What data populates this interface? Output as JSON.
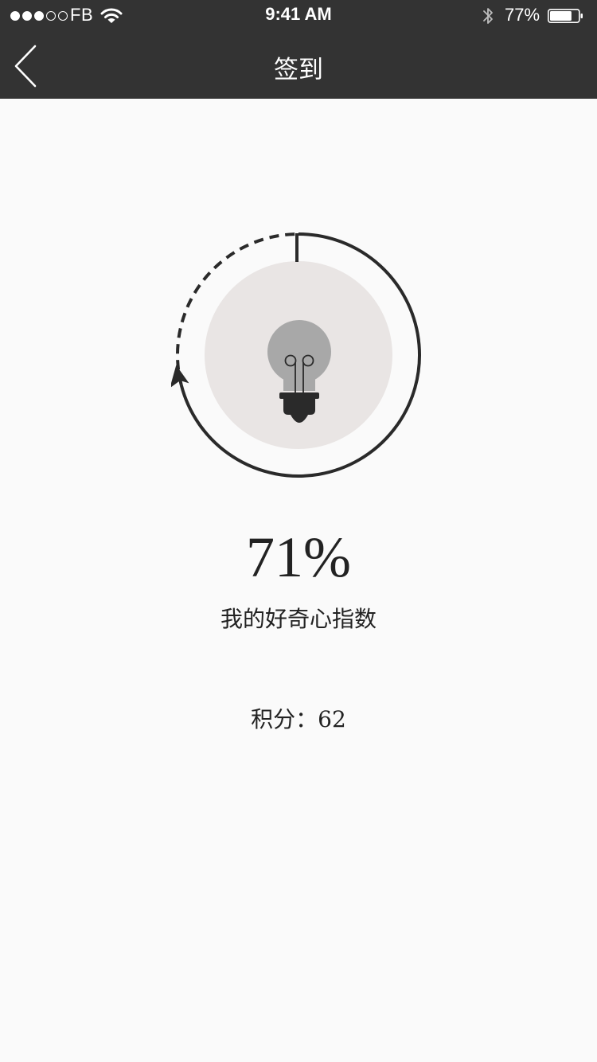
{
  "status_bar": {
    "carrier": "FB",
    "time": "9:41 AM",
    "battery_percent": "77%",
    "signal_bars_filled": 3,
    "signal_bars_total": 5,
    "battery_level": 0.77
  },
  "nav": {
    "back_icon": "chevron-left-icon",
    "title": "签到"
  },
  "curiosity": {
    "percent_text": "71%",
    "progress": 0.71,
    "label": "我的好奇心指数",
    "icon": "lightbulb-icon"
  },
  "points": {
    "text": "积分：62"
  },
  "colors": {
    "topbar": "#333333",
    "background": "#fafafa",
    "ring": "#2a2a2a",
    "circle_fill": "#e9e5e4",
    "bulb_glass": "#a8a8a8",
    "bulb_base": "#2a2a2a"
  }
}
